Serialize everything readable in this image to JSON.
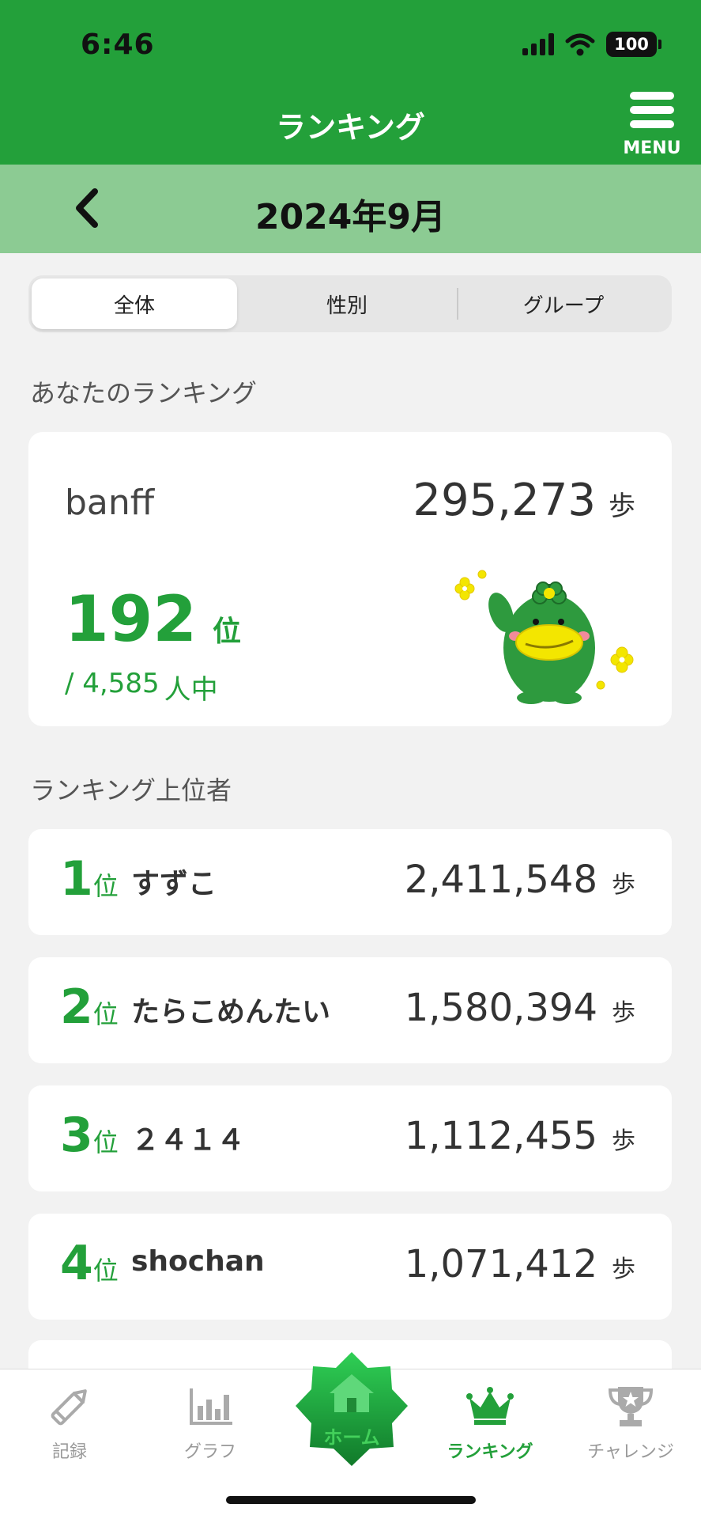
{
  "status_bar": {
    "time": "6:46",
    "battery": "100"
  },
  "header": {
    "title": "ランキング",
    "menu_label": "MENU"
  },
  "month_bar": {
    "month": "2024年9月"
  },
  "segments": [
    {
      "label": "全体",
      "active": true
    },
    {
      "label": "性別",
      "active": false
    },
    {
      "label": "グループ",
      "active": false
    }
  ],
  "my_ranking": {
    "section_title": "あなたのランキング",
    "username": "banff",
    "steps": "295,273",
    "steps_unit": "歩",
    "rank": "192",
    "rank_unit": "位",
    "total_prefix": "/ 4,585",
    "total_suffix": "人中"
  },
  "top_rankers": {
    "section_title": "ランキング上位者",
    "rank_unit": "位",
    "steps_unit": "歩",
    "items": [
      {
        "rank": "1",
        "name": "すずこ",
        "steps": "2,411,548"
      },
      {
        "rank": "2",
        "name": "たらこめんたい",
        "steps": "1,580,394"
      },
      {
        "rank": "3",
        "name": "２４１４",
        "steps": "1,112,455"
      },
      {
        "rank": "4",
        "name": "shochan",
        "steps": "1,071,412"
      }
    ]
  },
  "bottom_nav": {
    "record": "記録",
    "graph": "グラフ",
    "home": "ホーム",
    "ranking": "ランキング",
    "challenge": "チャレンジ"
  },
  "colors": {
    "primary_green": "#23a03a",
    "light_green": "#8ccb93",
    "background": "#f2f2f2",
    "mascot_green": "#2e9a3e",
    "mascot_yellow": "#f3e600"
  },
  "icons": [
    "signal-icon",
    "wifi-icon",
    "battery-icon",
    "menu-icon",
    "back-chevron-icon",
    "pencil-icon",
    "bar-chart-icon",
    "house-icon",
    "crown-icon",
    "trophy-icon",
    "mascot-kappa"
  ]
}
